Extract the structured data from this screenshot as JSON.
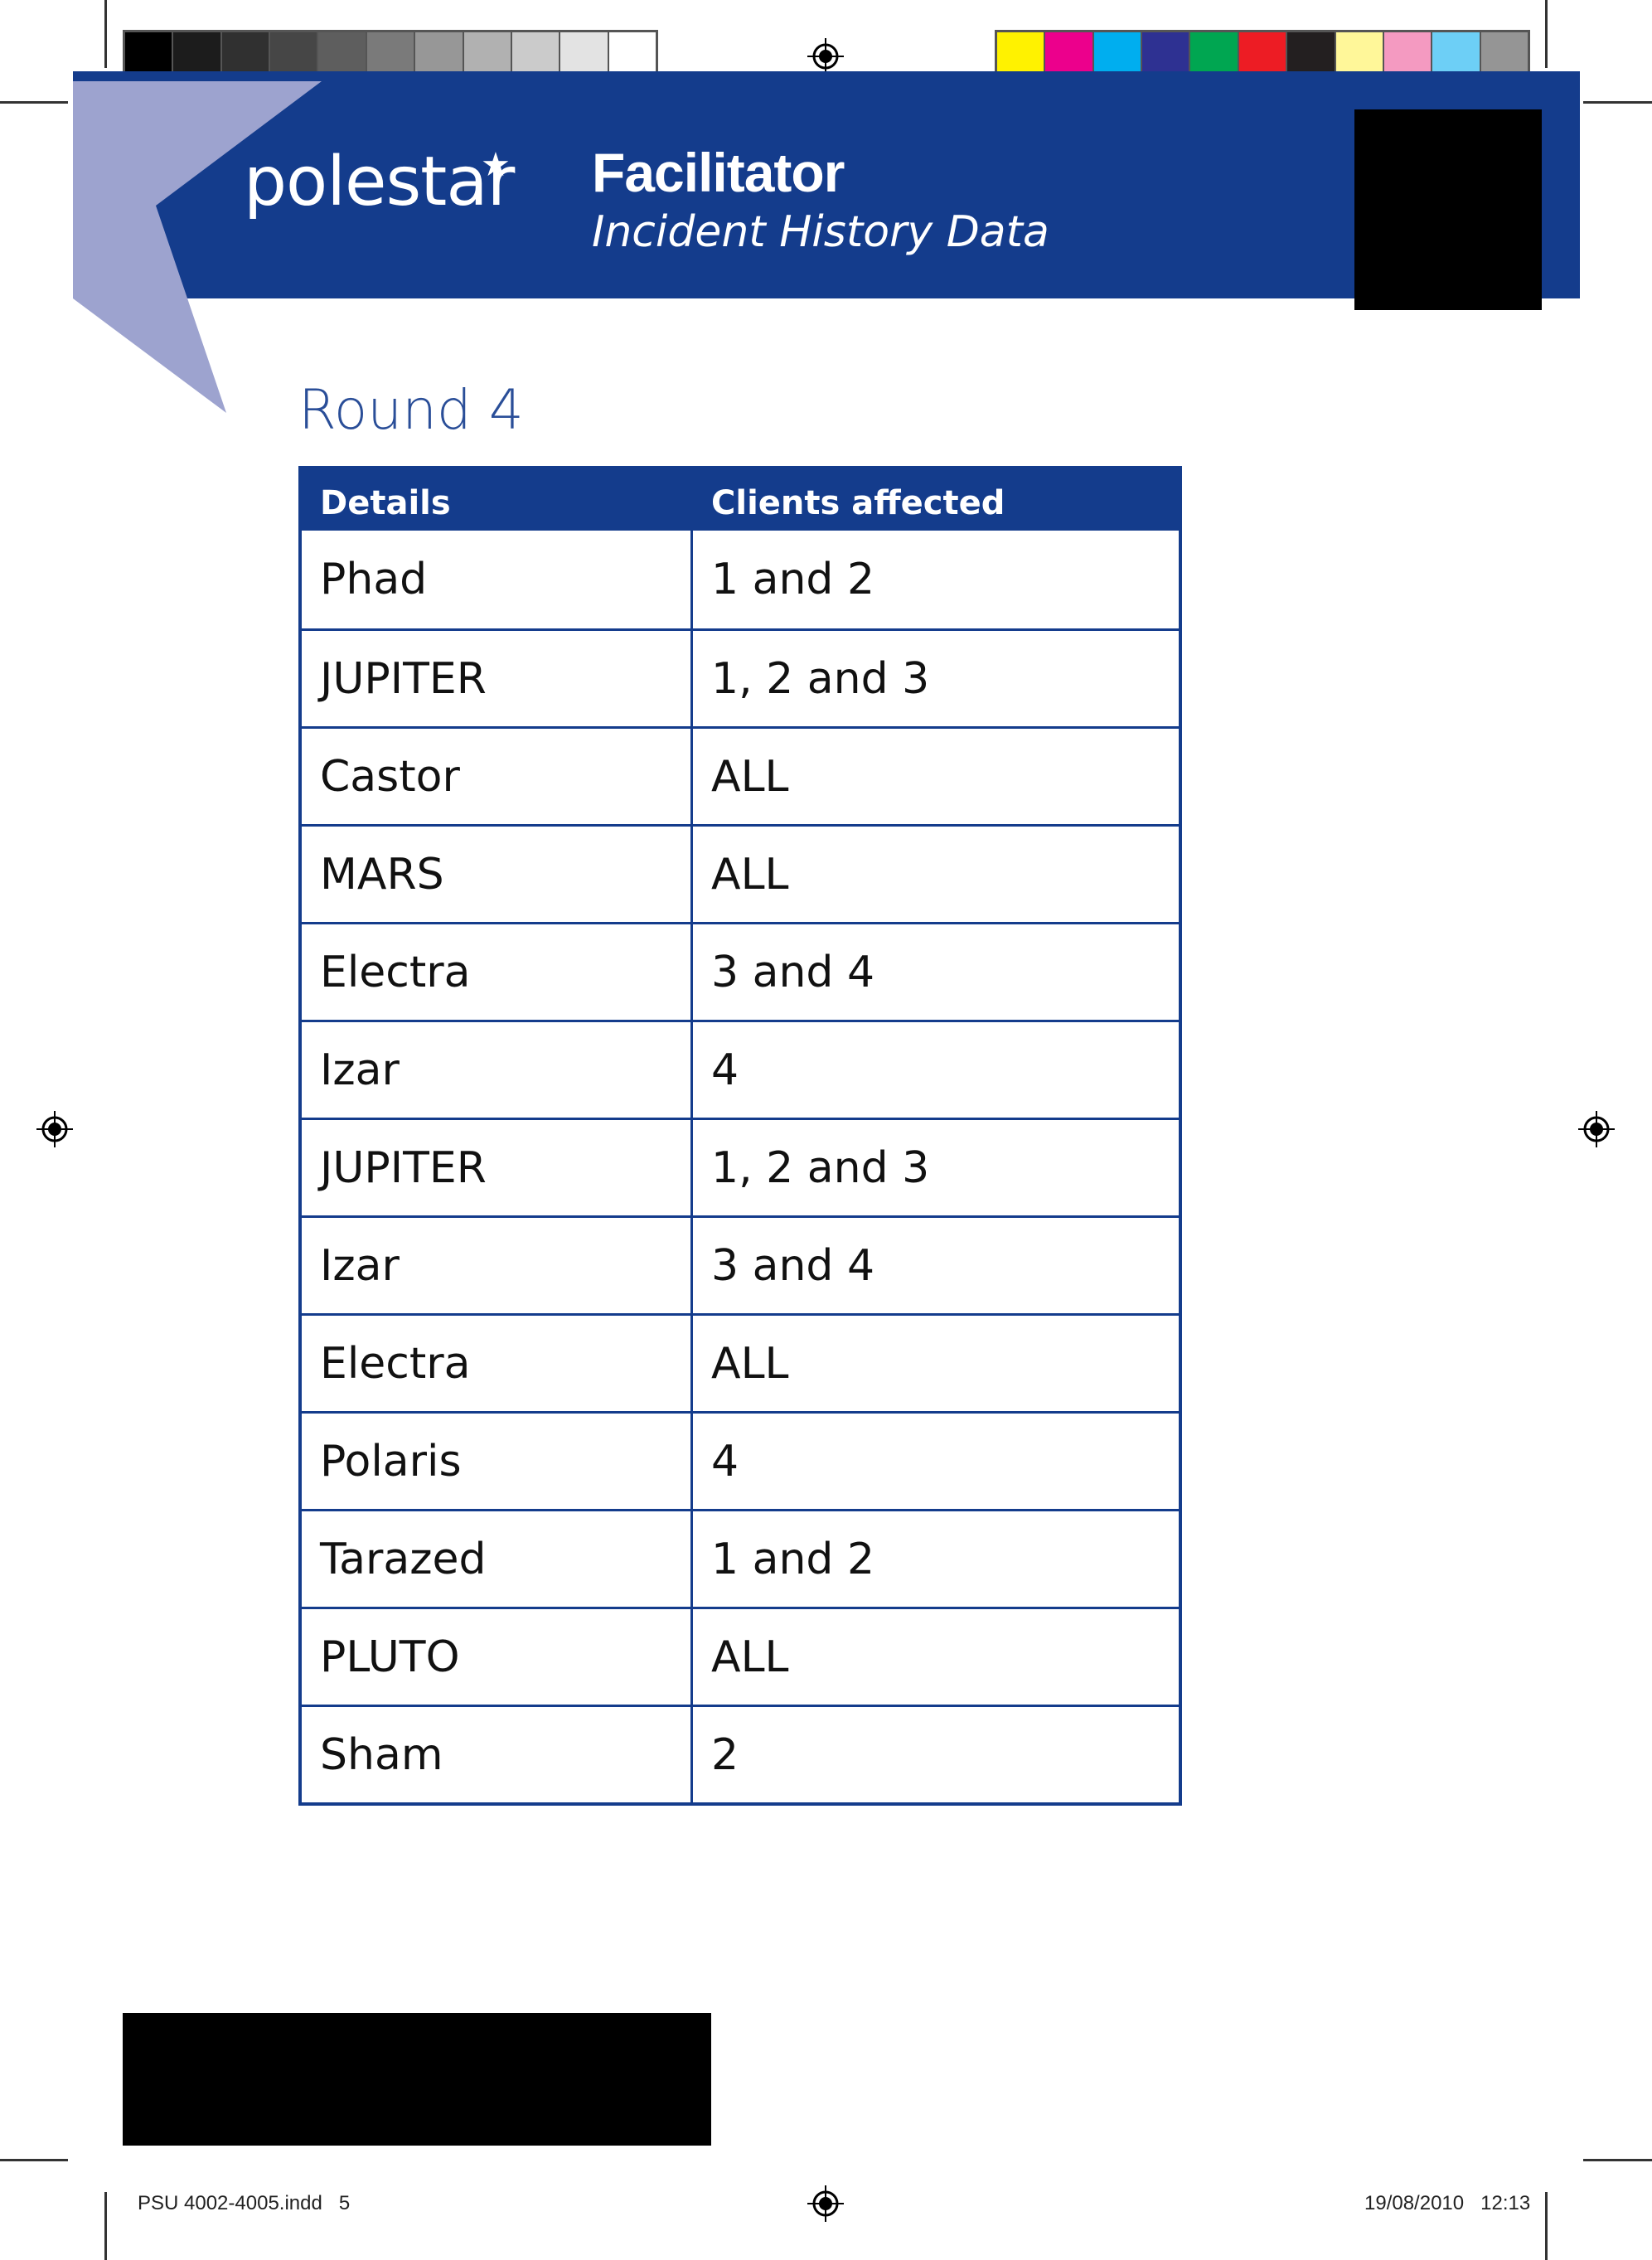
{
  "colors": {
    "brand_blue": "#143c8c",
    "triangle_lavender": "#9da3cf",
    "round_title_blue": "#2a4e98",
    "gray_swatches": [
      "#000000",
      "#1c1c1c",
      "#303030",
      "#464646",
      "#5e5e5e",
      "#7a7a7a",
      "#979797",
      "#b1b1b1",
      "#cbcbcb",
      "#e3e3e3",
      "#ffffff"
    ],
    "color_swatches": [
      "#fff200",
      "#ec008c",
      "#00aeef",
      "#2e3192",
      "#00a651",
      "#ed1c24",
      "#231f20",
      "#fff799",
      "#f49ac1",
      "#6dcff6",
      "#959595"
    ]
  },
  "header": {
    "logo": "polestar",
    "title": "Facilitator",
    "subtitle": "Incident History Data"
  },
  "round_title": "Round 4",
  "table": {
    "headers": [
      "Details",
      "Clients affected"
    ],
    "rows": [
      [
        "Phad",
        "1 and 2"
      ],
      [
        "JUPITER",
        "1, 2 and 3"
      ],
      [
        "Castor",
        "ALL"
      ],
      [
        "MARS",
        "ALL"
      ],
      [
        "Electra",
        "3 and 4"
      ],
      [
        "Izar",
        "4"
      ],
      [
        "JUPITER",
        "1, 2 and 3"
      ],
      [
        "Izar",
        "3 and 4"
      ],
      [
        "Electra",
        "ALL"
      ],
      [
        "Polaris",
        "4"
      ],
      [
        "Tarazed",
        "1 and 2"
      ],
      [
        "PLUTO",
        "ALL"
      ],
      [
        "Sham",
        "2"
      ]
    ]
  },
  "slug": {
    "file": "PSU 4002-4005.indd   5",
    "datetime": "19/08/2010   12:13"
  }
}
